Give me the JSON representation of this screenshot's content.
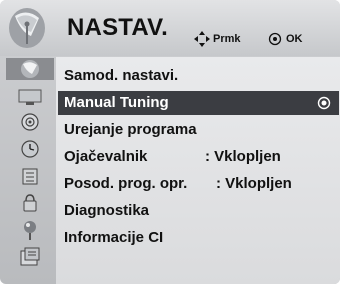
{
  "header": {
    "title": "NASTAV.",
    "hint_move": "Prmk",
    "hint_ok": "OK"
  },
  "sidebar": {
    "icons": [
      "picture-setup-icon",
      "tv-screen-icon",
      "speaker-icon",
      "clock-icon",
      "lock-icon",
      "option-icon",
      "usb-icon",
      "network-icon"
    ],
    "active_index": 0
  },
  "menu": {
    "items": [
      {
        "label": "Samod. nastavi.",
        "value": ""
      },
      {
        "label": "Manual Tuning",
        "value": ""
      },
      {
        "label": "Urejanje programa",
        "value": ""
      },
      {
        "label": "Ojačevalnik",
        "value": ": Vklopljen"
      },
      {
        "label": "Posod. prog. opr.",
        "value": ": Vklopljen"
      },
      {
        "label": "Diagnostika",
        "value": ""
      },
      {
        "label": "Informacije CI",
        "value": ""
      }
    ],
    "selected_index": 1
  },
  "colors": {
    "selected_bg": "#3b3d42",
    "panel_bg": "#e4e5e7",
    "header_bg": "#d4d5d8"
  }
}
